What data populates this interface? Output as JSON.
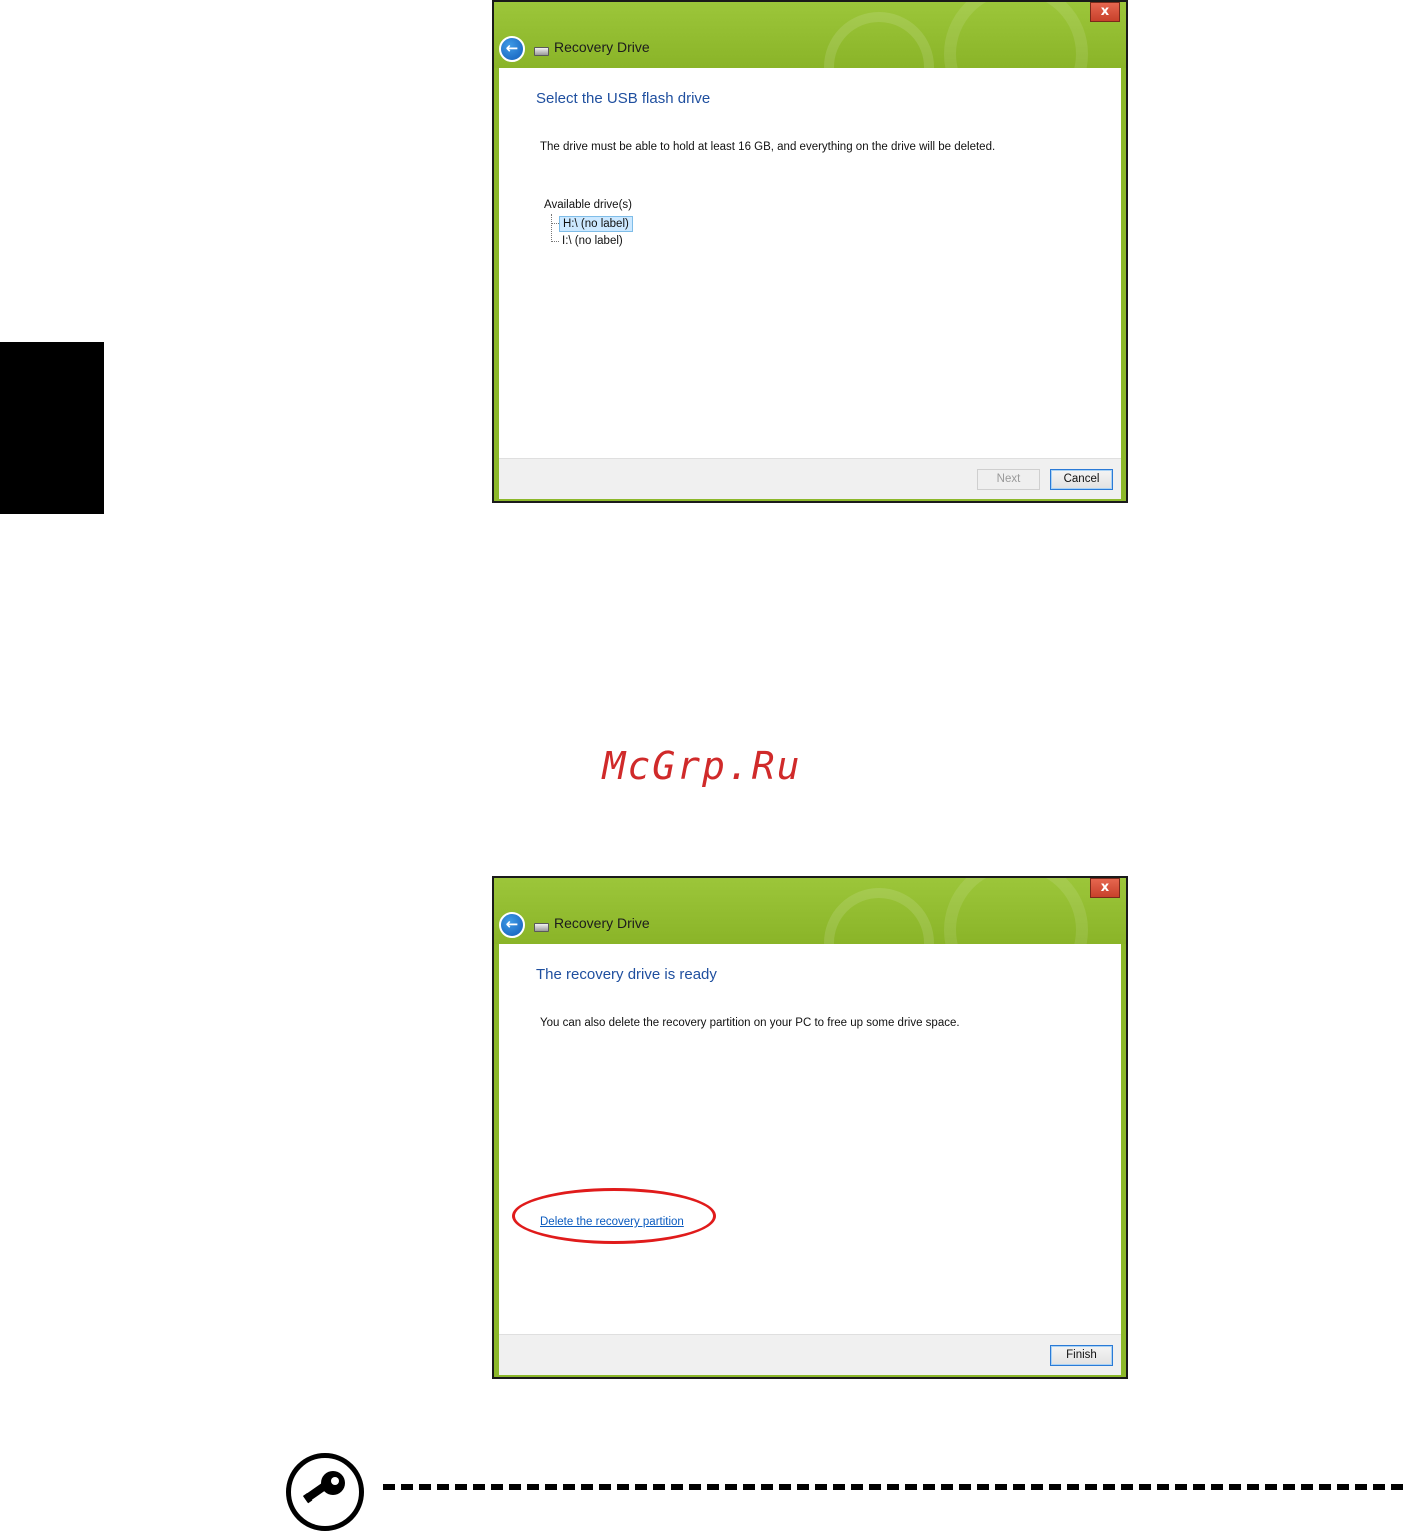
{
  "dialogs": [
    {
      "title": "Recovery Drive",
      "close_glyph": "x",
      "heading": "Select the USB flash drive",
      "body": "The drive must be able to hold at least 16 GB, and everything on the drive will be deleted.",
      "tree_label": "Available drive(s)",
      "drives": [
        {
          "label": "H:\\ (no label)",
          "selected": true
        },
        {
          "label": "I:\\ (no label)",
          "selected": false
        }
      ],
      "buttons": {
        "next": "Next",
        "cancel": "Cancel"
      }
    },
    {
      "title": "Recovery Drive",
      "close_glyph": "x",
      "heading": "The recovery drive is ready",
      "body": "You can also delete the recovery partition on your PC to free up some drive space.",
      "link": "Delete the recovery partition",
      "buttons": {
        "finish": "Finish"
      }
    }
  ],
  "watermark": "McGrp.Ru",
  "colors": {
    "titlebar_green": "#8cb82a",
    "heading_blue": "#1f4f9f",
    "link_blue": "#0b5bbf",
    "highlight_red": "#e01b1b"
  },
  "icons": [
    "back-arrow-icon",
    "drive-icon",
    "close-icon",
    "key-note-icon"
  ]
}
